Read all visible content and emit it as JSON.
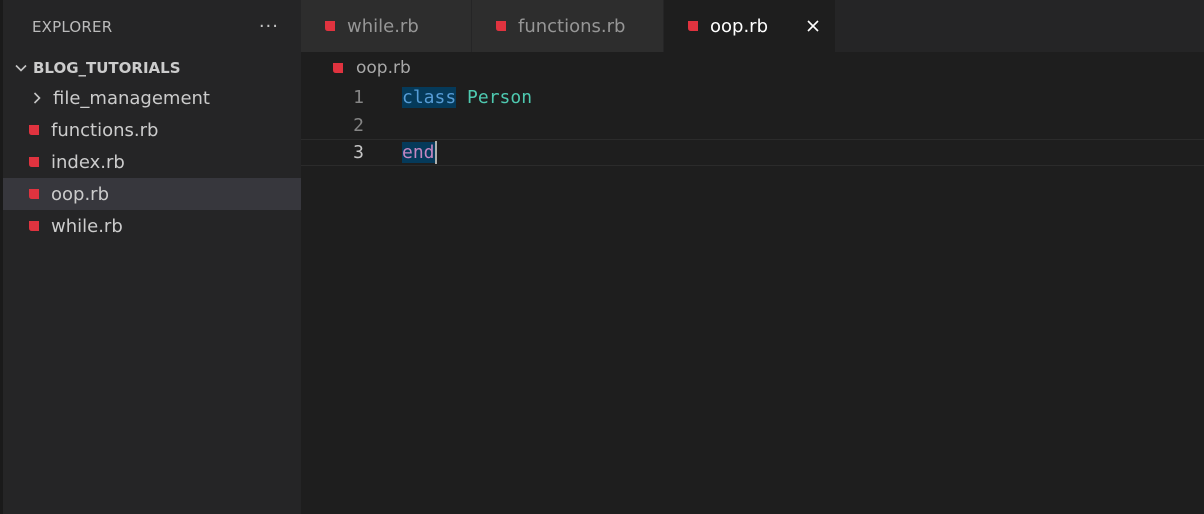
{
  "sidebar": {
    "title": "EXPLORER",
    "more": "···",
    "root_folder": "BLOG_TUTORIALS",
    "items": [
      {
        "label": "file_management",
        "type": "folder"
      },
      {
        "label": "functions.rb",
        "type": "file"
      },
      {
        "label": "index.rb",
        "type": "file"
      },
      {
        "label": "oop.rb",
        "type": "file",
        "selected": true
      },
      {
        "label": "while.rb",
        "type": "file"
      }
    ]
  },
  "tabs": [
    {
      "label": "while.rb",
      "active": false
    },
    {
      "label": "functions.rb",
      "active": false
    },
    {
      "label": "oop.rb",
      "active": true
    }
  ],
  "breadcrumb": {
    "file": "oop.rb"
  },
  "editor": {
    "lines": [
      {
        "number": "1",
        "keyword": "class",
        "name": "Person"
      },
      {
        "number": "2"
      },
      {
        "number": "3",
        "keyword": "end",
        "current": true
      }
    ]
  },
  "colors": {
    "ruby_icon": "#e0333f",
    "keyword": "#569cd6",
    "end_keyword": "#c586c0",
    "class_name": "#4ec9b0",
    "selection": "#053a5a"
  },
  "icons": {
    "file": "ruby-file-icon",
    "folder_collapsed": "chevron-right-icon",
    "folder_expanded": "chevron-down-icon",
    "close": "close-icon"
  }
}
